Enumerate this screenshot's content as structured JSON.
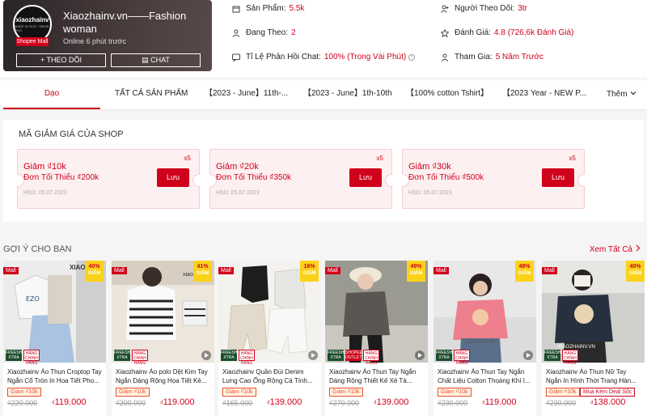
{
  "shop": {
    "name": "Xiaozhainv.vn——Fashion woman",
    "online": "Online 6 phút trước",
    "avatar_text": "xiaozhainv",
    "avatar_sub": "MADE IN 2019 · SINCE 2019",
    "mall_label": "Shopee Mall",
    "follow_label": "THEO DÕI",
    "chat_label": "CHAT"
  },
  "stats": [
    {
      "label": "Sản Phẩm:",
      "value": "5.5k",
      "icon": "store-icon"
    },
    {
      "label": "Người Theo Dõi:",
      "value": "3tr",
      "icon": "followers-icon"
    },
    {
      "label": "Đang Theo:",
      "value": "2",
      "icon": "following-icon"
    },
    {
      "label": "Đánh Giá:",
      "value": "4.8 (726,6k Đánh Giá)",
      "icon": "star-icon"
    },
    {
      "label": "Tỉ Lệ Phản Hồi Chat:",
      "value": "100% (Trong Vài Phút)",
      "icon": "chat-bubble-icon"
    },
    {
      "label": "Tham Gia:",
      "value": "5 Năm Trước",
      "icon": "user-join-icon"
    }
  ],
  "tabs": [
    {
      "label": "Dạo"
    },
    {
      "label": "TẤT CẢ SẢN PHẨM"
    },
    {
      "label": "【2023 - June】11th-..."
    },
    {
      "label": "【2023 - June】1th-10th"
    },
    {
      "label": "【100% cotton Tshirt】"
    },
    {
      "label": "【2023 Year - NEW P..."
    },
    {
      "label": "Thêm"
    }
  ],
  "vouchers": {
    "title": "MÃ GIẢM GIÁ CỦA SHOP",
    "items": [
      {
        "discount": "Giảm ₫10k",
        "min": "Đơn Tối Thiểu ₫200k",
        "hsd": "HSD: 05.07.2023",
        "qty": "x5",
        "btn": "Lưu"
      },
      {
        "discount": "Giảm ₫20k",
        "min": "Đơn Tối Thiểu ₫350k",
        "hsd": "HSD: 05.07.2023",
        "qty": "x5",
        "btn": "Lưu"
      },
      {
        "discount": "Giảm ₫30k",
        "min": "Đơn Tối Thiểu ₫500k",
        "hsd": "HSD: 05.07.2023",
        "qty": "x5",
        "btn": "Lưu"
      }
    ]
  },
  "recommend": {
    "title": "GỢI Ý CHO BẠN",
    "see_all": "Xem Tất Cả",
    "products": [
      {
        "name": "Xiaozhainv Áo Thun Croptop Tay Ngắn Cổ Tròn In Hoa Tiết Pho...",
        "tag": "Giảm ₫10k",
        "old": "₫220.000",
        "new": "119.000",
        "disc": "40%",
        "disc_label": "GIẢM",
        "mall": "Mall",
        "img_text": "XIAOZ"
      },
      {
        "name": "Xiaozhainv Áo polo Dệt Kim Tay Ngắn Dáng Rộng Họa Tiết Kẻ...",
        "tag": "Giảm ₫10k",
        "old": "₫200.000",
        "new": "119.000",
        "disc": "41%",
        "disc_label": "GIẢM",
        "mall": "Mall",
        "img_text": "xiao"
      },
      {
        "name": "Xiaozhainv Quần Đùi Denim Lưng Cao Ống Rộng Cá Tính...",
        "tag": "Giảm ₫10k",
        "old": "₫165.000",
        "new": "139.000",
        "disc": "16%",
        "disc_label": "GIẢM",
        "mall": "Mall",
        "img_text": ""
      },
      {
        "name": "Xiaozhainv Áo Thun Tay Ngắn Dáng Rộng Thiết Kế Xẻ Tà...",
        "tag": "Giảm ₫10k",
        "old": "₫270.000",
        "new": "139.000",
        "disc": "49%",
        "disc_label": "GIẢM",
        "mall": "Mall",
        "img_text": ""
      },
      {
        "name": "Xiaozhainv Áo Thun Tay Ngắn Chất Liệu Cotton Thoáng Khí I...",
        "tag": "Giảm ₫10k",
        "old": "₫230.000",
        "new": "119.000",
        "disc": "48%",
        "disc_label": "GIẢM",
        "mall": "Mall",
        "img_text": "OZHAINV.VN"
      },
      {
        "name": "Xiaozhainv Áo Thun Nữ Tay Ngắn In Hình Thời Trang Hàn...",
        "tag": "Giảm ₫10k",
        "tag2": "Mua Kèm Deal Sốc",
        "old": "₫230.000",
        "new": "138.000",
        "disc": "40%",
        "disc_label": "GIẢM",
        "mall": "Mall",
        "img_text": "XIAOZHAINV.VN"
      }
    ],
    "badge_freeship": "FREESHIP XTRA",
    "badge_genuine": "HÀNG CHÍNH HÃNG",
    "badge_outlet": "SHOPEE OUTLET"
  },
  "colors": {
    "accent": "#d0011b",
    "promo": "#ee4d2d"
  }
}
